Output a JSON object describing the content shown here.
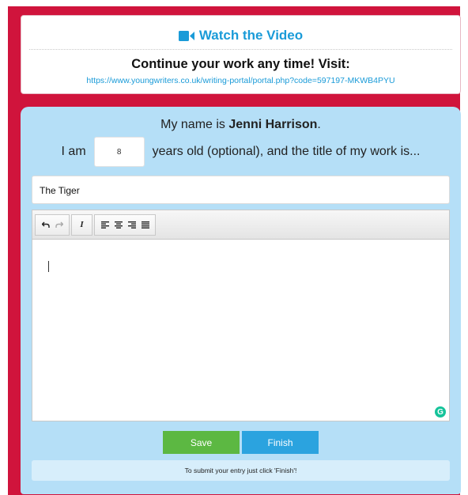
{
  "header": {
    "video_link_label": "Watch the Video",
    "continue_text": "Continue your work any time! Visit:",
    "portal_url": "https://www.youngwriters.co.uk/writing-portal/portal.php?code=597197-MKWB4PYU"
  },
  "form": {
    "name_prefix": "My name is",
    "name_value": "Jenni Harrison",
    "name_suffix": ".",
    "age_prefix": "I am",
    "age_value": "8",
    "age_suffix": "years old (optional), and the title of my work is...",
    "title_value": "The Tiger"
  },
  "toolbar": {
    "undo": "undo-icon",
    "redo": "redo-icon",
    "italic_label": "I",
    "align_left": "align-left-icon",
    "align_center": "align-center-icon",
    "align_right": "align-right-icon",
    "align_justify": "align-justify-icon"
  },
  "editor": {
    "content": "",
    "grammarly_badge": "G"
  },
  "actions": {
    "save_label": "Save",
    "finish_label": "Finish",
    "submit_note": "To submit your entry just click 'Finish'!"
  },
  "colors": {
    "frame": "#d0143c",
    "panel": "#b5dff7",
    "link": "#1a9bd8",
    "save": "#5cb842",
    "finish": "#2ba3df"
  }
}
